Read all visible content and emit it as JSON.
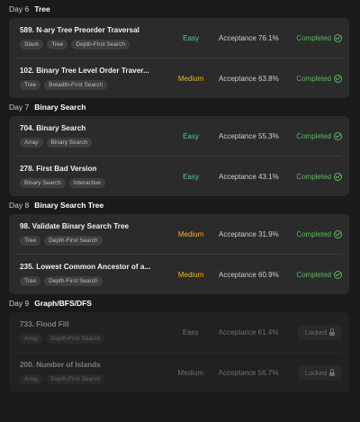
{
  "days": [
    {
      "day": "Day 6",
      "topic": "Tree",
      "problems": [
        {
          "title": "589. N-ary Tree Preorder Traversal",
          "tags": [
            "Stack",
            "Tree",
            "Depth-First Search"
          ],
          "difficulty": "Easy",
          "acceptance": "Acceptance 76.1%",
          "status": "Completed"
        },
        {
          "title": "102. Binary Tree Level Order Traver...",
          "tags": [
            "Tree",
            "Breadth-First Search"
          ],
          "difficulty": "Medium",
          "acceptance": "Acceptance 63.8%",
          "status": "Completed"
        }
      ]
    },
    {
      "day": "Day 7",
      "topic": "Binary Search",
      "problems": [
        {
          "title": "704. Binary Search",
          "tags": [
            "Array",
            "Binary Search"
          ],
          "difficulty": "Easy",
          "acceptance": "Acceptance 55.3%",
          "status": "Completed"
        },
        {
          "title": "278. First Bad Version",
          "tags": [
            "Binary Search",
            "Interactive"
          ],
          "difficulty": "Easy",
          "acceptance": "Acceptance 43.1%",
          "status": "Completed"
        }
      ]
    },
    {
      "day": "Day 8",
      "topic": "Binary Search Tree",
      "problems": [
        {
          "title": "98. Validate Binary Search Tree",
          "tags": [
            "Tree",
            "Depth-First Search"
          ],
          "difficulty": "Medium",
          "acceptance": "Acceptance 31.9%",
          "status": "Completed"
        },
        {
          "title": "235. Lowest Common Ancestor of a...",
          "tags": [
            "Tree",
            "Depth-First Search"
          ],
          "difficulty": "Medium",
          "acceptance": "Acceptance 60.9%",
          "status": "Completed"
        }
      ]
    },
    {
      "day": "Day 9",
      "topic": "Graph/BFS/DFS",
      "locked": true,
      "problems": [
        {
          "title": "733. Flood Fill",
          "tags": [
            "Array",
            "Depth-First Search"
          ],
          "difficulty": "Easy",
          "acceptance": "Acceptance 61.4%",
          "status": "Locked"
        },
        {
          "title": "200. Number of Islands",
          "tags": [
            "Array",
            "Depth-First Search"
          ],
          "difficulty": "Medium",
          "acceptance": "Acceptance 56.7%",
          "status": "Locked"
        }
      ]
    }
  ]
}
